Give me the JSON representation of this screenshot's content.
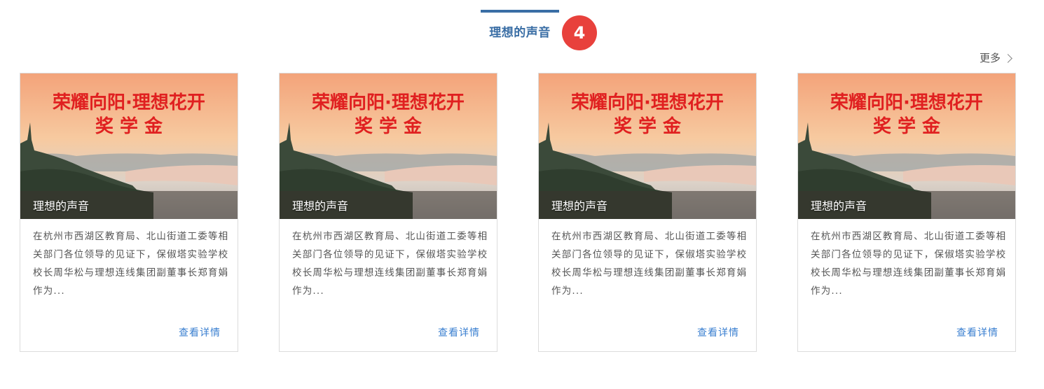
{
  "section": {
    "title": "理想的声音",
    "badge": "4",
    "more_label": "更多"
  },
  "colors": {
    "accent": "#3a6ea5",
    "badge": "#e8413c",
    "link": "#3a7fd0"
  },
  "banner": {
    "line1": "荣耀向阳·理想花开",
    "line2": "奖 学 金"
  },
  "cards": [
    {
      "overlay_title": "理想的声音",
      "description": "在杭州市西湖区教育局、北山街道工委等相关部门各位领导的见证下，保俶塔实验学校校长周华松与理想连线集团副董事长郑育娟作为...",
      "detail_label": "查看详情"
    },
    {
      "overlay_title": "理想的声音",
      "description": "在杭州市西湖区教育局、北山街道工委等相关部门各位领导的见证下，保俶塔实验学校校长周华松与理想连线集团副董事长郑育娟作为...",
      "detail_label": "查看详情"
    },
    {
      "overlay_title": "理想的声音",
      "description": "在杭州市西湖区教育局、北山街道工委等相关部门各位领导的见证下，保俶塔实验学校校长周华松与理想连线集团副董事长郑育娟作为...",
      "detail_label": "查看详情"
    },
    {
      "overlay_title": "理想的声音",
      "description": "在杭州市西湖区教育局、北山街道工委等相关部门各位领导的见证下，保俶塔实验学校校长周华松与理想连线集团副董事长郑育娟作为...",
      "detail_label": "查看详情"
    }
  ]
}
